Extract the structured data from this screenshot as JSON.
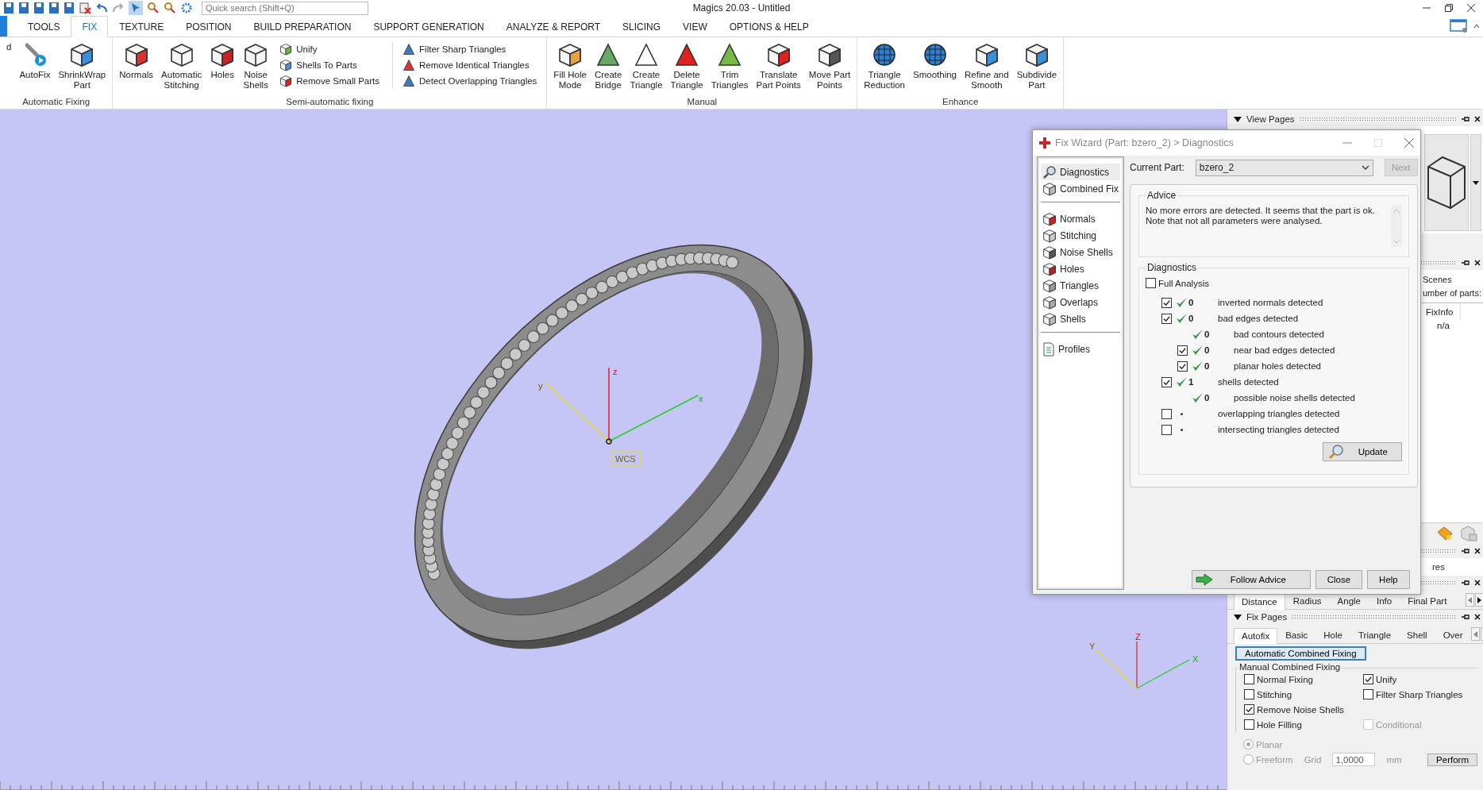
{
  "window": {
    "title": "Magics 20.03 - Untitled",
    "quick_search": {
      "placeholder": "Quick search (Shift+Q)"
    }
  },
  "ribbon_tabs": [
    {
      "label": "TOOLS",
      "selected": false
    },
    {
      "label": "FIX",
      "selected": true
    },
    {
      "label": "TEXTURE",
      "selected": false
    },
    {
      "label": "POSITION",
      "selected": false
    },
    {
      "label": "BUILD PREPARATION",
      "selected": false
    },
    {
      "label": "SUPPORT GENERATION",
      "selected": false
    },
    {
      "label": "ANALYZE & REPORT",
      "selected": false
    },
    {
      "label": "SLICING",
      "selected": false
    },
    {
      "label": "VIEW",
      "selected": false
    },
    {
      "label": "OPTIONS & HELP",
      "selected": false
    }
  ],
  "ribbon_groups": [
    {
      "label": "Automatic Fixing",
      "items": [
        {
          "kind": "large",
          "label": "d"
        },
        {
          "kind": "large",
          "label": "AutoFix"
        },
        {
          "kind": "large",
          "label": "ShrinkWrap\nPart"
        }
      ]
    },
    {
      "label": "Semi-automatic fixing",
      "items": [
        {
          "kind": "large",
          "label": "Normals"
        },
        {
          "kind": "large",
          "label": "Automatic\nStitching"
        },
        {
          "kind": "large",
          "label": "Holes"
        },
        {
          "kind": "large",
          "label": "Noise\nShells"
        },
        {
          "kind": "small",
          "label": "Unify"
        },
        {
          "kind": "small",
          "label": "Shells To Parts"
        },
        {
          "kind": "small",
          "label": "Remove Small Parts"
        },
        {
          "kind": "small",
          "label": "Filter Sharp Triangles"
        },
        {
          "kind": "small",
          "label": "Remove Identical Triangles"
        },
        {
          "kind": "small",
          "label": "Detect Overlapping Triangles"
        }
      ]
    },
    {
      "label": "Manual",
      "items": [
        {
          "kind": "large",
          "label": "Fill Hole\nMode"
        },
        {
          "kind": "large",
          "label": "Create\nBridge"
        },
        {
          "kind": "large",
          "label": "Create\nTriangle"
        },
        {
          "kind": "large",
          "label": "Delete\nTriangle"
        },
        {
          "kind": "large",
          "label": "Trim\nTriangles"
        },
        {
          "kind": "large",
          "label": "Translate\nPart Points"
        },
        {
          "kind": "large",
          "label": "Move Part\nPoints"
        }
      ]
    },
    {
      "label": "Enhance",
      "items": [
        {
          "kind": "large",
          "label": "Triangle\nReduction"
        },
        {
          "kind": "large",
          "label": "Smoothing"
        },
        {
          "kind": "large",
          "label": "Refine and\nSmooth"
        },
        {
          "kind": "large",
          "label": "Subdivide\nPart"
        }
      ]
    }
  ],
  "viewport": {
    "axis_labels": {
      "z": "z",
      "x": "x",
      "y": "y"
    },
    "origin_label": "WCS",
    "triad_labels": {
      "z": "Z",
      "x": "X",
      "y": "Y"
    }
  },
  "view_pages": {
    "title": "View Pages"
  },
  "scene_panel": {
    "scenes_label": "Scenes",
    "parts_label": "umber of parts:",
    "columns": [
      "FixInfo"
    ],
    "rows": [
      [
        "n/a"
      ]
    ]
  },
  "panel_3": {
    "text": "res"
  },
  "measurement_pages": {
    "tabs": [
      {
        "label": "Distance",
        "selected": true
      },
      {
        "label": "Radius",
        "selected": false
      },
      {
        "label": "Angle",
        "selected": false
      },
      {
        "label": "Info",
        "selected": false
      },
      {
        "label": "Final Part",
        "selected": false
      }
    ]
  },
  "fix_pages": {
    "title": "Fix Pages",
    "tabs": [
      {
        "label": "Autofix",
        "selected": true
      },
      {
        "label": "Basic",
        "selected": false
      },
      {
        "label": "Hole",
        "selected": false
      },
      {
        "label": "Triangle",
        "selected": false
      },
      {
        "label": "Shell",
        "selected": false
      },
      {
        "label": "Over",
        "selected": false
      }
    ],
    "auto_button": "Automatic Combined Fixing",
    "manual_group": {
      "title": "Manual Combined Fixing",
      "rows": [
        [
          {
            "label": "Normal Fixing",
            "checked": false,
            "disabled": false
          },
          {
            "label": "Unify",
            "checked": true,
            "disabled": false
          }
        ],
        [
          {
            "label": "Stitching",
            "checked": false,
            "disabled": false
          },
          {
            "label": "Filter Sharp Triangles",
            "checked": false,
            "disabled": false
          }
        ],
        [
          {
            "label": "Remove Noise Shells",
            "checked": true,
            "disabled": false
          }
        ],
        [
          {
            "label": "Hole Filling",
            "checked": false,
            "disabled": false
          },
          {
            "label": "Conditional",
            "checked": false,
            "disabled": true
          }
        ]
      ]
    },
    "radios": [
      {
        "label": "Planar",
        "selected": true,
        "disabled": true
      },
      {
        "label": "Freeform",
        "selected": false,
        "disabled": true
      }
    ],
    "grid": {
      "label": "Grid",
      "value": "1,0000",
      "unit": "mm"
    },
    "perform": "Perform"
  },
  "fix_wizard": {
    "title": "Fix Wizard (Part: bzero_2) > Diagnostics",
    "nav": [
      [
        {
          "label": "Diagnostics",
          "selected": true
        },
        {
          "label": "Combined Fix",
          "selected": false
        }
      ],
      [
        {
          "label": "Normals",
          "selected": false
        },
        {
          "label": "Stitching",
          "selected": false
        },
        {
          "label": "Noise Shells",
          "selected": false
        },
        {
          "label": "Holes",
          "selected": false
        },
        {
          "label": "Triangles",
          "selected": false
        },
        {
          "label": "Overlaps",
          "selected": false
        },
        {
          "label": "Shells",
          "selected": false
        }
      ],
      [
        {
          "label": "Profiles",
          "selected": false
        }
      ]
    ],
    "current_part_label": "Current Part:",
    "current_part": "bzero_2",
    "next": {
      "label": "Next",
      "disabled": true
    },
    "advice": {
      "title": "Advice",
      "text": "No more errors are detected. It seems that the part is ok.\nNote that not all parameters were analysed."
    },
    "diagnostics": {
      "title": "Diagnostics",
      "full_analysis": {
        "label": "Full Analysis",
        "checked": false
      },
      "rows": [
        {
          "kind": "checkbox",
          "checked": true,
          "ok": true,
          "count": "0",
          "label": "inverted normals detected"
        },
        {
          "kind": "checkbox",
          "checked": true,
          "ok": true,
          "count": "0",
          "label": "bad edges detected",
          "children": [
            {
              "kind": "plain",
              "ok": true,
              "count": "0",
              "label": "bad contours detected"
            },
            {
              "kind": "checkbox",
              "checked": true,
              "ok": true,
              "count": "0",
              "label": "near bad edges detected"
            },
            {
              "kind": "checkbox",
              "checked": true,
              "ok": true,
              "count": "0",
              "label": "planar holes detected"
            }
          ]
        },
        {
          "kind": "checkbox",
          "checked": true,
          "ok": true,
          "count": "1",
          "label": "shells detected",
          "children": [
            {
              "kind": "plain",
              "ok": true,
              "count": "0",
              "label": "possible noise shells detected"
            }
          ]
        },
        {
          "kind": "checkbox",
          "checked": false,
          "ok": false,
          "label": "overlapping triangles detected"
        },
        {
          "kind": "checkbox",
          "checked": false,
          "ok": false,
          "label": "intersecting triangles detected"
        }
      ]
    },
    "update": "Update",
    "buttons": [
      "Follow Advice",
      "Close",
      "Help"
    ]
  }
}
